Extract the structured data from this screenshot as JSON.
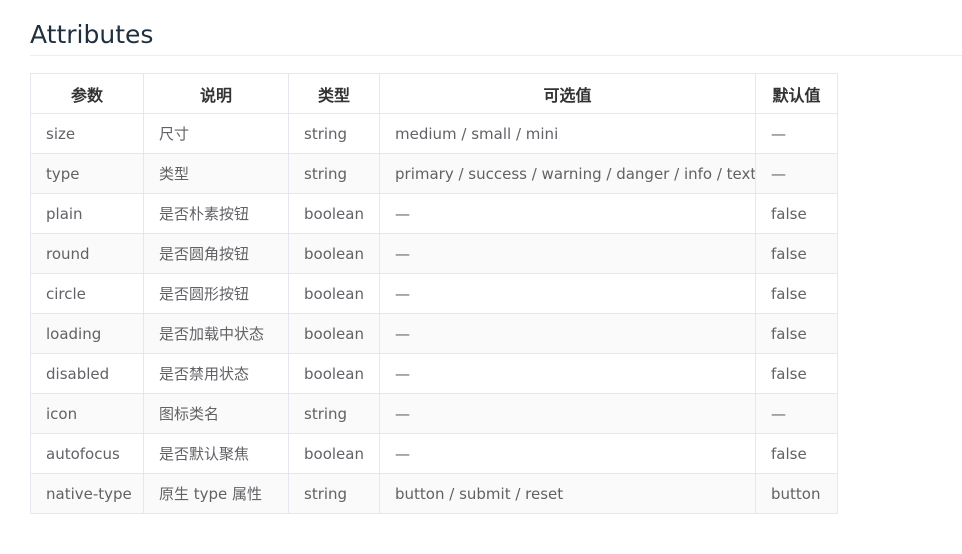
{
  "section": {
    "title": "Attributes"
  },
  "table": {
    "columns": [
      "参数",
      "说明",
      "类型",
      "可选值",
      "默认值"
    ],
    "rows": [
      [
        "size",
        "尺寸",
        "string",
        "medium / small / mini",
        "—"
      ],
      [
        "type",
        "类型",
        "string",
        "primary / success / warning / danger / info / text",
        "—"
      ],
      [
        "plain",
        "是否朴素按钮",
        "boolean",
        "—",
        "false"
      ],
      [
        "round",
        "是否圆角按钮",
        "boolean",
        "—",
        "false"
      ],
      [
        "circle",
        "是否圆形按钮",
        "boolean",
        "—",
        "false"
      ],
      [
        "loading",
        "是否加载中状态",
        "boolean",
        "—",
        "false"
      ],
      [
        "disabled",
        "是否禁用状态",
        "boolean",
        "—",
        "false"
      ],
      [
        "icon",
        "图标类名",
        "string",
        "—",
        "—"
      ],
      [
        "autofocus",
        "是否默认聚焦",
        "boolean",
        "—",
        "false"
      ],
      [
        "native-type",
        "原生 type 属性",
        "string",
        "button / submit / reset",
        "button"
      ]
    ]
  }
}
